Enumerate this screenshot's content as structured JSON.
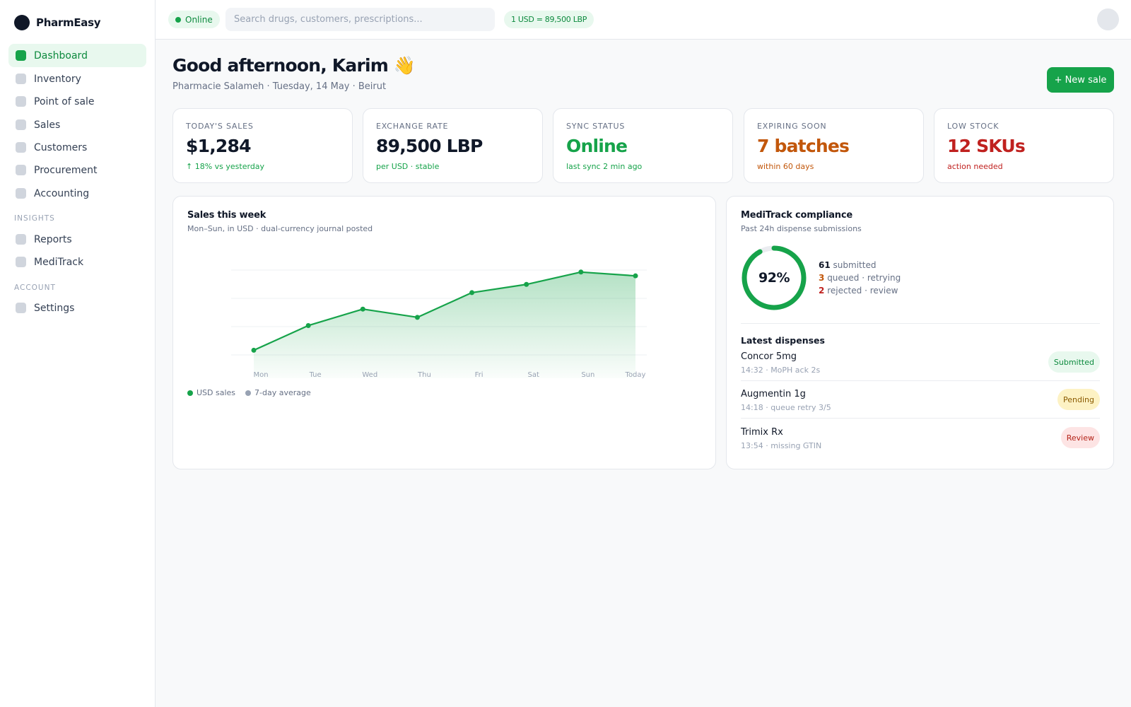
{
  "brand": {
    "name": "PharmEasy"
  },
  "sidebar": {
    "items": [
      {
        "label": "Dashboard",
        "active": true
      },
      {
        "label": "Inventory"
      },
      {
        "label": "Point of sale"
      },
      {
        "label": "Sales"
      },
      {
        "label": "Customers"
      },
      {
        "label": "Procurement"
      },
      {
        "label": "Accounting"
      }
    ],
    "insights_label": "INSIGHTS",
    "insights": [
      {
        "label": "Reports"
      },
      {
        "label": "MediTrack"
      }
    ],
    "account_label": "ACCOUNT",
    "account": [
      {
        "label": "Settings"
      }
    ]
  },
  "topbar": {
    "status": "Online",
    "search_placeholder": "Search drugs, customers, prescriptions...",
    "rate": "1 USD = 89,500 LBP"
  },
  "header": {
    "greeting": "Good afternoon, Karim 👋",
    "subtitle": "Pharmacie Salameh · Tuesday, 14 May · Beirut",
    "new_sale": "+ New sale"
  },
  "kpis": [
    {
      "label": "Today's sales",
      "value": "$1,284",
      "note": "↑ 18% vs yesterday",
      "color": "#101828",
      "note_color": "#16a34a"
    },
    {
      "label": "Exchange rate",
      "value": "89,500 LBP",
      "note": "per USD · stable",
      "color": "#101828",
      "note_color": "#16a34a"
    },
    {
      "label": "Sync status",
      "value": "Online",
      "note": "last sync 2 min ago",
      "color": "#16a34a",
      "note_color": "#16a34a"
    },
    {
      "label": "Expiring soon",
      "value": "7 batches",
      "note": "within 60 days",
      "color": "#c2570b",
      "note_color": "#c2570b"
    },
    {
      "label": "Low stock",
      "value": "12 SKUs",
      "note": "action needed",
      "color": "#c0211f",
      "note_color": "#c0211f"
    }
  ],
  "sales_card": {
    "title": "Sales this week",
    "subtitle": "Mon–Sun, in USD · dual-currency journal posted",
    "legend_usd": "USD sales",
    "legend_avg": "7-day average"
  },
  "chart_data": {
    "type": "area",
    "categories": [
      "Mon",
      "Tue",
      "Wed",
      "Thu",
      "Fri",
      "Sat",
      "Sun",
      "Today"
    ],
    "series": [
      {
        "name": "USD sales",
        "values": [
          770,
          920,
          1020,
          970,
          1120,
          1170,
          1245,
          1222
        ],
        "color": "#16a34a"
      }
    ],
    "ylim": [
      600,
      1300
    ],
    "grid": true
  },
  "compliance": {
    "title": "MediTrack compliance",
    "subtitle": "Past 24h dispense submissions",
    "percent_label": "92%",
    "percent": 92,
    "submitted_count": "61",
    "submitted_text": "submitted",
    "queued_count": "3",
    "queued_text": "queued · retrying",
    "rejected_count": "2",
    "rejected_text": "rejected · review",
    "latest_title": "Latest dispenses",
    "dispenses": [
      {
        "name": "Concor 5mg",
        "meta": "14:32 · MoPH ack 2s",
        "status": "Submitted",
        "bg": "#e8f8ee",
        "fg": "#0d8a3e"
      },
      {
        "name": "Augmentin 1g",
        "meta": "14:18 · queue retry 3/5",
        "status": "Pending",
        "bg": "#fdf2c4",
        "fg": "#8a5a00"
      },
      {
        "name": "Trimix Rx",
        "meta": "13:54 · missing GTIN",
        "status": "Review",
        "bg": "#fde4e4",
        "fg": "#b42318"
      }
    ]
  }
}
